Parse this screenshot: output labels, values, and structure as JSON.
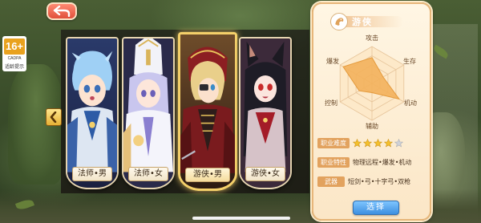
{
  "header": {
    "back_label": ""
  },
  "age_rating": {
    "value": "16+",
    "org": "CADPA",
    "tip": "适龄提示"
  },
  "characters": [
    {
      "name": "法师•男",
      "selected": false
    },
    {
      "name": "法师•女",
      "selected": false
    },
    {
      "name": "游侠•男",
      "selected": true
    },
    {
      "name": "游侠•女",
      "selected": false
    }
  ],
  "info": {
    "class_title": "游侠",
    "radar_labels": {
      "attack": "攻击",
      "survival": "生存",
      "mobility": "机动",
      "support": "辅助",
      "control": "控制",
      "burst": "爆发"
    },
    "radar_values": {
      "attack": 0.7,
      "survival": 0.35,
      "mobility": 0.85,
      "support": 0.25,
      "control": 0.4,
      "burst": 0.9
    },
    "difficulty_label": "职业难度",
    "difficulty_stars": 4,
    "difficulty_max": 5,
    "trait_label": "职业特性",
    "trait_value": "物理远程•爆发•机动",
    "weapon_label": "武器",
    "weapon_value": "短剑•弓•十字弓•双枪",
    "select_label": "选择"
  },
  "colors": {
    "accent_gold": "#f4d06a",
    "button_blue": "#3d8fe0",
    "tag_orange": "#e2a25e",
    "back_red": "#e0503b"
  },
  "icons": [
    "back-arrow-icon",
    "left-arrow-icon",
    "class-icon",
    "star-icon"
  ]
}
